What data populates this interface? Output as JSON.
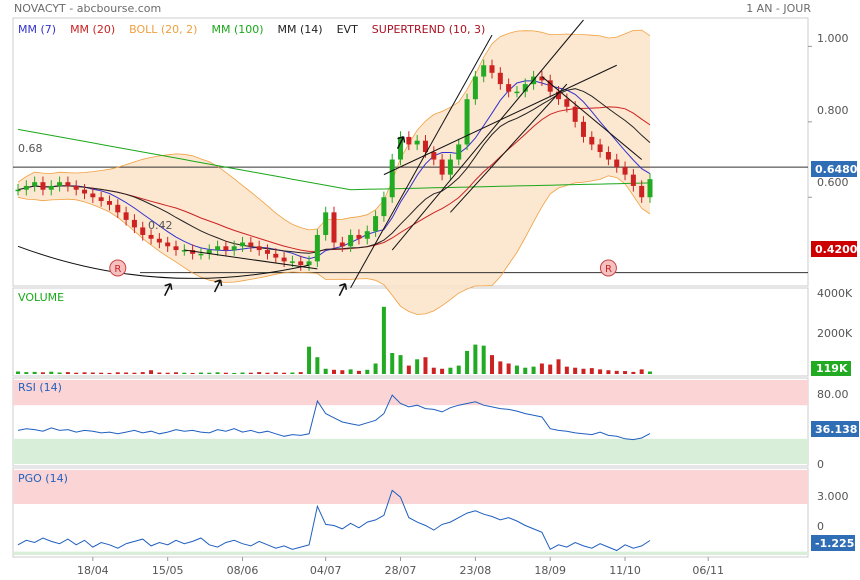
{
  "header": {
    "title": "NOVACYT - abcbourse.com",
    "period": "1 AN - JOUR"
  },
  "legend": [
    {
      "label": "MM (7)",
      "color": "#3333cc"
    },
    {
      "label": "MM (20)",
      "color": "#cc2222"
    },
    {
      "label": "BOLL (20, 2)",
      "color": "#f0a040"
    },
    {
      "label": "MM (100)",
      "color": "#1aa81a"
    },
    {
      "label": "MM (14)",
      "color": "#222222"
    },
    {
      "label": "EVT",
      "color": "#222222"
    },
    {
      "label": "SUPERTREND (10, 3)",
      "color": "#aa1122"
    }
  ],
  "colors": {
    "up": "#22aa22",
    "down": "#cc2222",
    "boll_fill": "#fbe3c8",
    "boll_line": "#f0a040",
    "mm7": "#3333cc",
    "mm20": "#cc2222",
    "mm100": "#1aa81a",
    "mm14": "#222222",
    "current_badge": "#2f6db5",
    "support_badge": "#cc0000",
    "volume_badge": "#22aa22",
    "rsi_line": "#1f5fbf",
    "pgo_line": "#1f5fbf",
    "overbought_zone": "#fbd5d5",
    "oversold_zone": "#d9eed9"
  },
  "icons": {
    "reversal_marker": "r-marker-icon",
    "arrow": "up-arrow-icon"
  },
  "price_panel": {
    "ylim": [
      0.37,
      1.07
    ],
    "y_ticks": [
      "1.000",
      "0.800",
      "0.600"
    ],
    "y_tick_values": [
      1.0,
      0.8,
      0.6
    ],
    "level_high_label": "0.68",
    "level_high": 0.68,
    "level_low_label": "0.42",
    "level_low": 0.4,
    "current_price": "0.6480",
    "support_price": "0.4200",
    "marker_letter": "R"
  },
  "volume_panel": {
    "title": "VOLUME",
    "y_ticks": [
      "4000K",
      "2000K"
    ],
    "current": "119K"
  },
  "rsi_panel": {
    "title": "RSI (14)",
    "y_ticks": [
      "80.00",
      "0"
    ],
    "current": "36.138"
  },
  "pgo_panel": {
    "title": "PGO (14)",
    "y_ticks": [
      "3.000",
      "0"
    ],
    "current": "-1.225"
  },
  "x_axis": {
    "labels": [
      "18/04",
      "15/05",
      "08/06",
      "04/07",
      "28/07",
      "23/08",
      "18/09",
      "11/10",
      "06/11"
    ]
  },
  "chart_data": {
    "type": "candlestick",
    "title": "NOVACYT",
    "series_price_close": [
      0.62,
      0.63,
      0.64,
      0.62,
      0.63,
      0.64,
      0.63,
      0.62,
      0.61,
      0.6,
      0.59,
      0.58,
      0.56,
      0.54,
      0.52,
      0.5,
      0.49,
      0.48,
      0.47,
      0.46,
      0.46,
      0.45,
      0.45,
      0.46,
      0.47,
      0.46,
      0.47,
      0.48,
      0.47,
      0.46,
      0.45,
      0.44,
      0.43,
      0.43,
      0.42,
      0.43,
      0.5,
      0.56,
      0.48,
      0.47,
      0.5,
      0.49,
      0.51,
      0.55,
      0.6,
      0.7,
      0.76,
      0.74,
      0.75,
      0.72,
      0.7,
      0.66,
      0.7,
      0.74,
      0.86,
      0.92,
      0.95,
      0.93,
      0.9,
      0.88,
      0.88,
      0.9,
      0.92,
      0.91,
      0.88,
      0.86,
      0.84,
      0.8,
      0.76,
      0.74,
      0.72,
      0.7,
      0.68,
      0.66,
      0.63,
      0.6,
      0.648
    ],
    "volume_k": [
      120,
      90,
      100,
      80,
      110,
      70,
      90,
      60,
      80,
      70,
      60,
      50,
      80,
      70,
      60,
      90,
      180,
      70,
      60,
      80,
      60,
      50,
      70,
      60,
      80,
      60,
      50,
      70,
      60,
      90,
      60,
      80,
      60,
      70,
      90,
      1300,
      800,
      250,
      200,
      180,
      220,
      150,
      200,
      500,
      3200,
      1000,
      900,
      400,
      700,
      800,
      300,
      250,
      300,
      400,
      1100,
      1400,
      1350,
      900,
      600,
      500,
      400,
      300,
      350,
      500,
      450,
      700,
      350,
      300,
      250,
      280,
      220,
      180,
      150,
      140,
      100,
      220,
      119
    ],
    "rsi": [
      40,
      42,
      41,
      39,
      43,
      40,
      41,
      38,
      40,
      39,
      37,
      38,
      36,
      38,
      40,
      37,
      39,
      36,
      38,
      41,
      39,
      40,
      38,
      37,
      41,
      39,
      42,
      38,
      40,
      37,
      39,
      36,
      33,
      35,
      34,
      36,
      75,
      60,
      55,
      50,
      48,
      46,
      49,
      52,
      60,
      82,
      72,
      68,
      70,
      66,
      65,
      62,
      67,
      70,
      72,
      74,
      70,
      68,
      66,
      65,
      63,
      60,
      58,
      56,
      42,
      40,
      39,
      37,
      36,
      35,
      38,
      34,
      33,
      30,
      29,
      31,
      36.138
    ],
    "pgo": [
      -1.6,
      -1.2,
      -1.4,
      -1.0,
      -1.3,
      -1.5,
      -1.1,
      -1.6,
      -1.2,
      -1.8,
      -1.4,
      -1.6,
      -1.9,
      -1.5,
      -1.3,
      -1.1,
      -1.7,
      -1.4,
      -1.6,
      -1.2,
      -1.5,
      -1.3,
      -1.0,
      -1.6,
      -1.8,
      -1.4,
      -1.2,
      -1.5,
      -1.7,
      -1.3,
      -1.6,
      -1.9,
      -1.7,
      -2.0,
      -1.8,
      -1.6,
      1.8,
      0.2,
      0.1,
      -0.2,
      0.3,
      -0.1,
      0.4,
      0.6,
      1.0,
      3.2,
      2.6,
      0.8,
      0.4,
      0.1,
      -0.3,
      0.2,
      0.4,
      0.8,
      1.2,
      1.4,
      1.1,
      0.9,
      0.6,
      0.8,
      0.5,
      0.1,
      -0.2,
      -0.5,
      -2.0,
      -1.6,
      -1.8,
      -1.4,
      -1.7,
      -1.9,
      -1.5,
      -1.8,
      -2.1,
      -1.6,
      -1.9,
      -1.7,
      -1.225
    ],
    "ylim_price": [
      0.37,
      1.07
    ],
    "ylim_volume": [
      0,
      4000
    ],
    "ylim_rsi": [
      0,
      100
    ],
    "ylim_pgo": [
      -2.5,
      5
    ],
    "rsi_overbought": 70,
    "rsi_oversold": 30,
    "pgo_high": 2,
    "pgo_low": -2.2,
    "x_tick_indices": [
      9,
      18,
      27,
      37,
      46,
      55,
      64,
      73,
      83
    ]
  }
}
